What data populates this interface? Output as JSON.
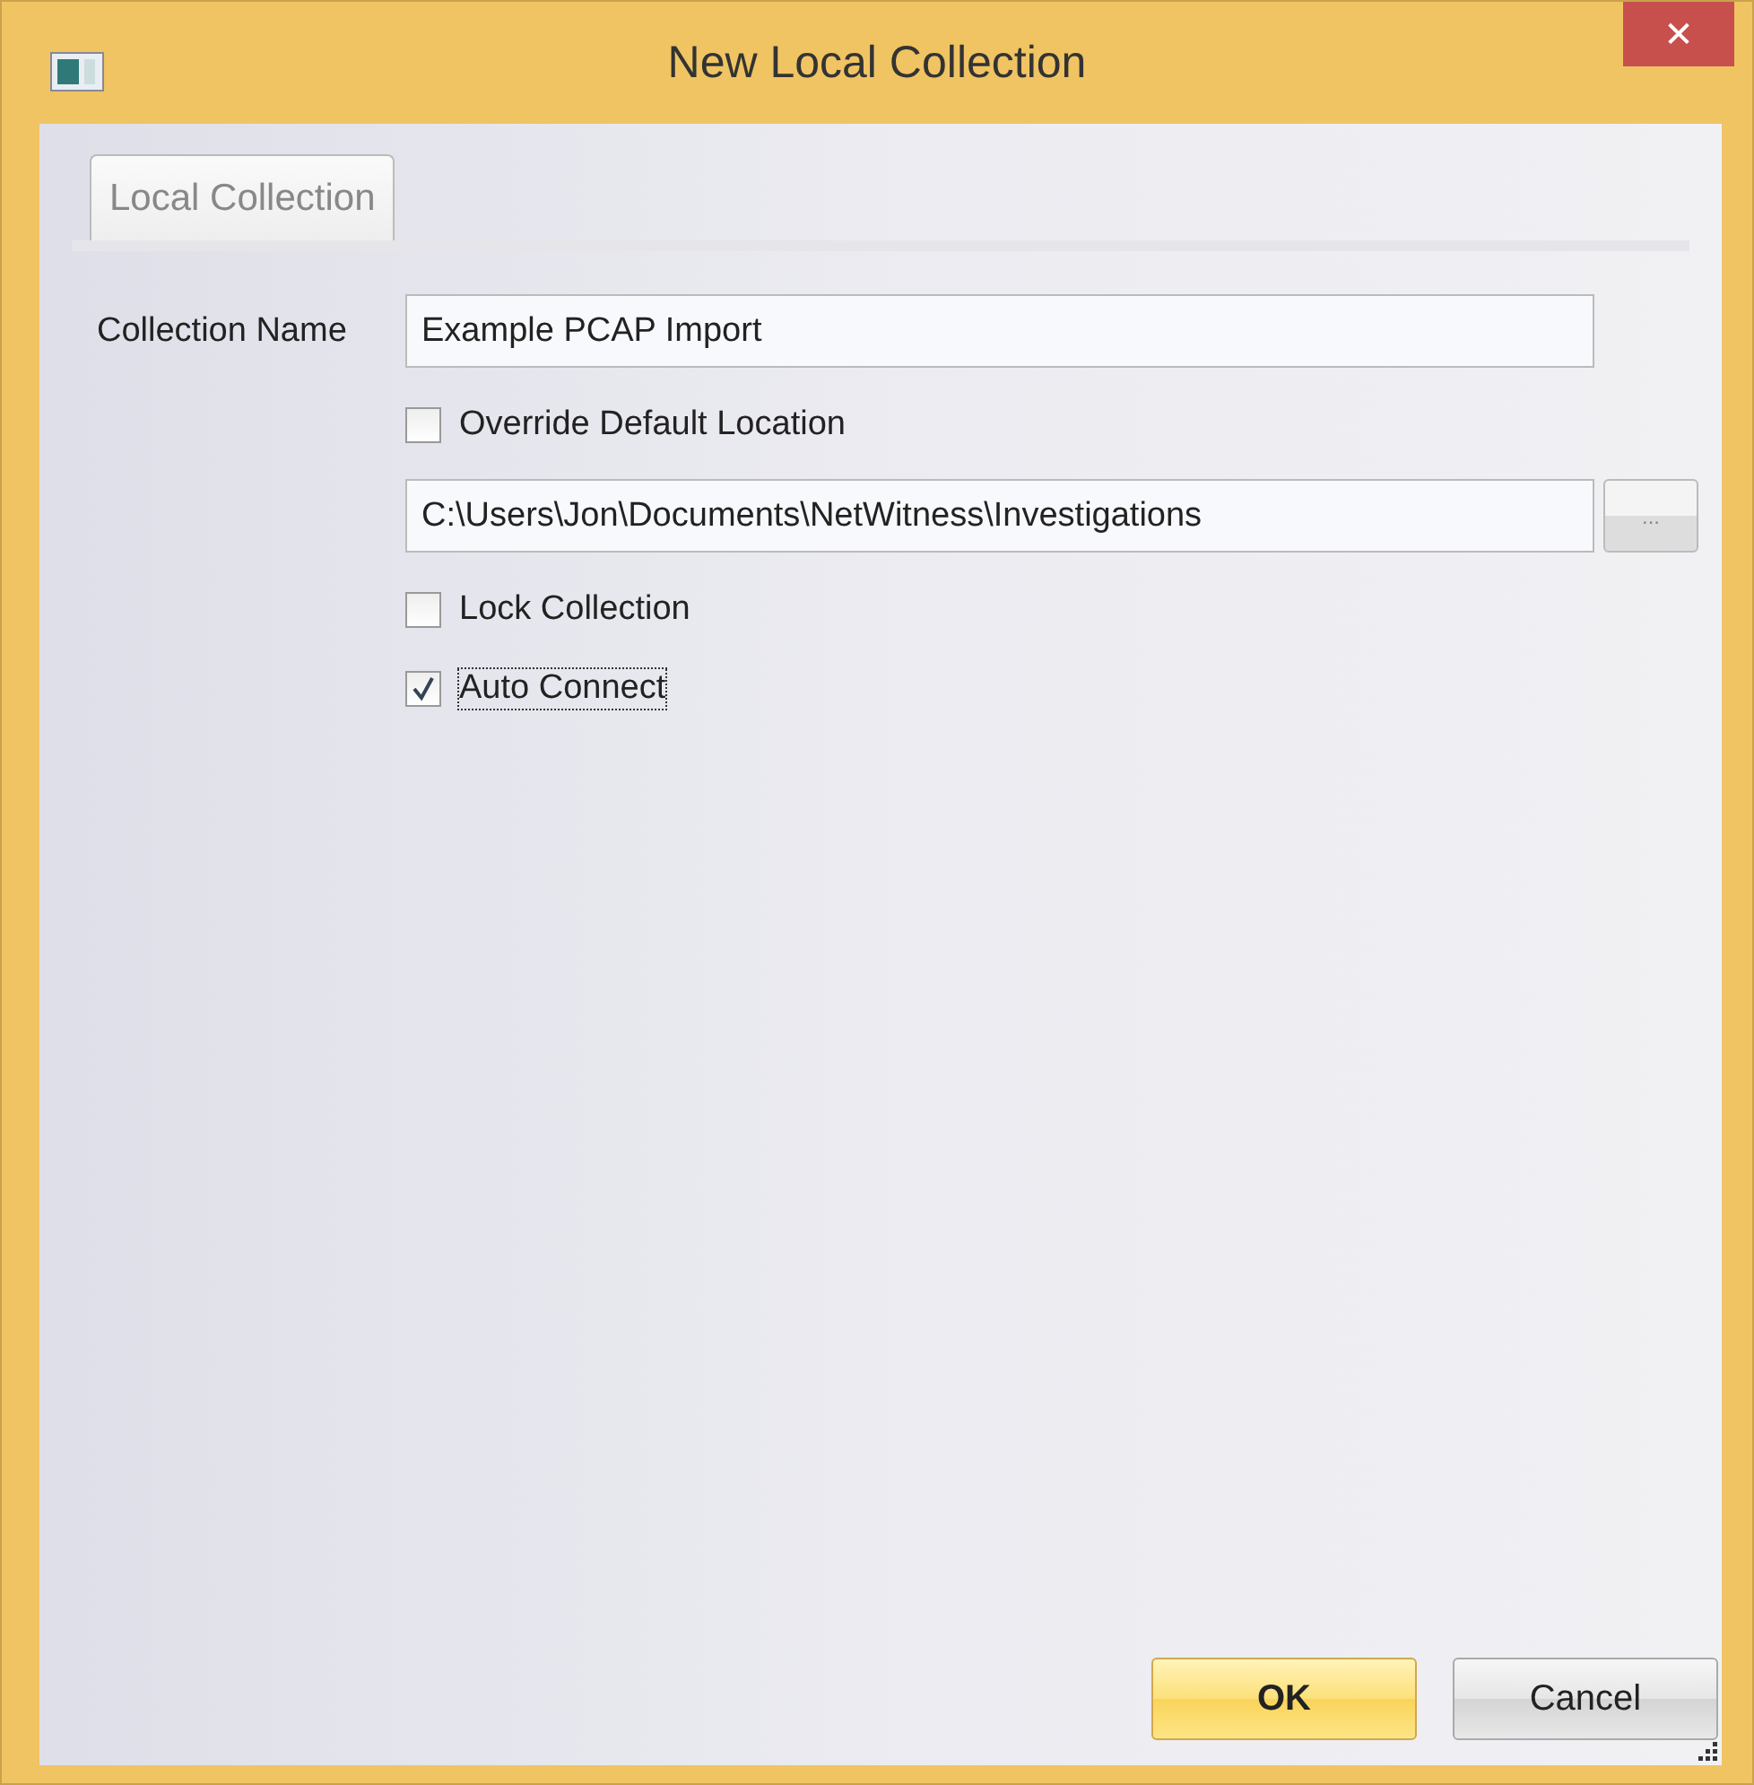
{
  "window": {
    "title": "New Local Collection",
    "close": "✕"
  },
  "tabs": [
    {
      "label": "Local Collection",
      "selected": true
    }
  ],
  "collection_name": {
    "label": "Collection Name",
    "value": "Example PCAP Import"
  },
  "override": {
    "label": "Override Default Location",
    "checked": false,
    "focused": false
  },
  "location": {
    "value": "C:\\Users\\Jon\\Documents\\NetWitness\\Investigations",
    "browse": "..."
  },
  "options": [
    {
      "label": "Lock Collection",
      "checked": false,
      "focused": false
    },
    {
      "label": "Auto Connect",
      "checked": true,
      "focused": true
    }
  ],
  "buttons": [
    {
      "label": "OK",
      "default": true
    },
    {
      "label": "Cancel",
      "default": false
    }
  ]
}
